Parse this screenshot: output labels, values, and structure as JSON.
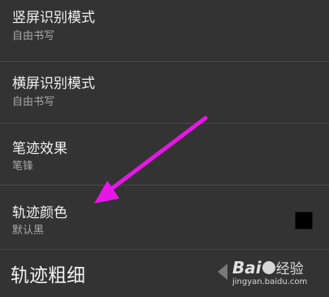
{
  "settings": {
    "items": [
      {
        "title": "竖屏识别模式",
        "summary": "自由书写"
      },
      {
        "title": "横屏识别模式",
        "summary": "自由书写"
      },
      {
        "title": "笔迹效果",
        "summary": "笔锋"
      },
      {
        "title": "轨迹颜色",
        "summary": "默认黑"
      }
    ],
    "partial_item_title": "轨迹粗细",
    "trail_color_value": "#000000"
  },
  "annotation": {
    "arrow_color": "#e617e6"
  },
  "watermark": {
    "logo_text_1": "Bai",
    "logo_text_2": "经验",
    "url": "jingyan.baidu.com"
  }
}
